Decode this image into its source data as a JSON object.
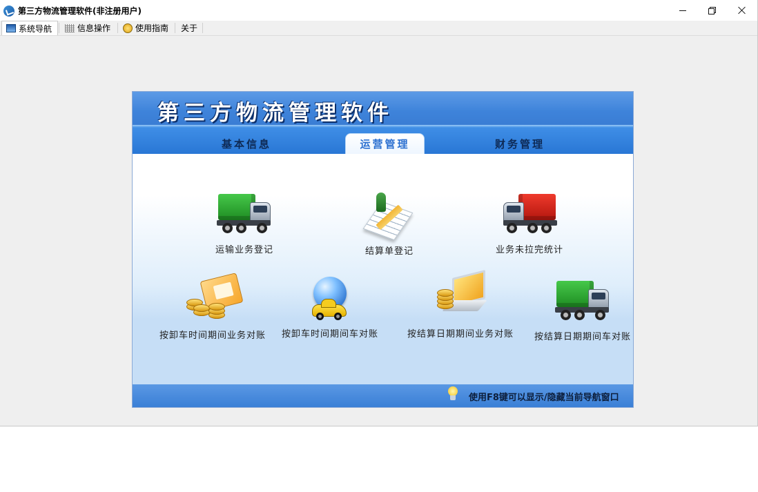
{
  "window": {
    "title": "第三方物流管理软件(非注册用户)",
    "controls": [
      "minimize",
      "restore",
      "close"
    ]
  },
  "tabs": [
    {
      "label": "系统导航",
      "icon": "nav-window-icon",
      "active": true
    },
    {
      "label": "信息操作",
      "icon": "grid-icon",
      "active": false
    },
    {
      "label": "使用指南",
      "icon": "guide-icon",
      "active": false
    },
    {
      "label": "关于",
      "icon": "",
      "active": false
    }
  ],
  "panel": {
    "title": "第三方物流管理软件",
    "tabs": [
      {
        "label": "基本信息",
        "active": false
      },
      {
        "label": "运营管理",
        "active": true
      },
      {
        "label": "财务管理",
        "active": false
      }
    ],
    "items": [
      {
        "label": "运输业务登记",
        "icon": "green-truck-icon"
      },
      {
        "label": "结算单登记",
        "icon": "invoice-pen-icon"
      },
      {
        "label": "业务未拉完统计",
        "icon": "red-truck-icon"
      },
      {
        "label": "按卸车时间期间业务对账",
        "icon": "coins-card-icon"
      },
      {
        "label": "按卸车时间期间车对账",
        "icon": "globe-car-icon"
      },
      {
        "label": "按结算日期期间业务对账",
        "icon": "coins-laptop-icon"
      },
      {
        "label": "按结算日期期间车对账",
        "icon": "green-truck-icon"
      }
    ],
    "footer_tip": "使用F8键可以显示/隐藏当前导航窗口"
  },
  "colors": {
    "header_blue": "#3e83da",
    "tab_text": "#0e2a55",
    "active_tab_text": "#2a6fd0"
  }
}
